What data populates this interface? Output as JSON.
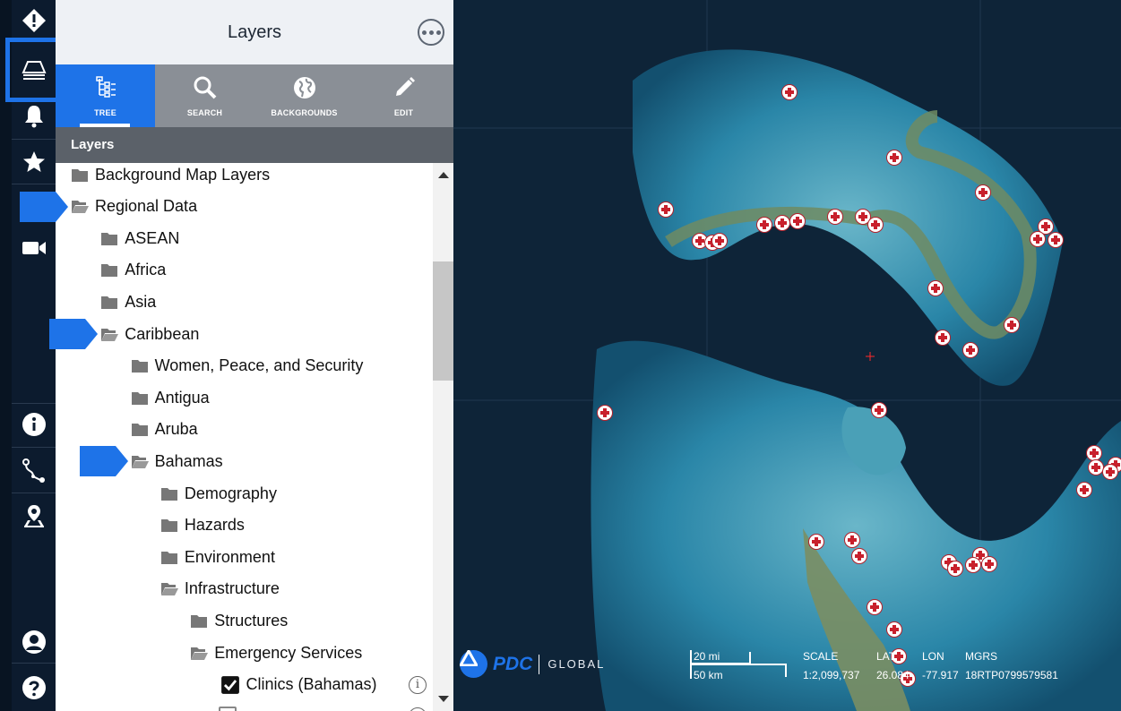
{
  "panel": {
    "title": "Layers",
    "section_header": "Layers",
    "tabs": [
      {
        "label": "TREE",
        "icon": "tree-icon",
        "active": true
      },
      {
        "label": "SEARCH",
        "icon": "search-icon",
        "active": false
      },
      {
        "label": "BACKGROUNDS",
        "icon": "globe-icon",
        "active": false
      },
      {
        "label": "EDIT",
        "icon": "pencil-icon",
        "active": false
      }
    ]
  },
  "rail": {
    "items": [
      "alert-diamond-icon",
      "layers-icon",
      "bell-icon",
      "star-icon",
      "chevron-down-icon",
      "video-camera-icon",
      "info-icon",
      "route-icon",
      "map-pin-icon",
      "user-icon",
      "help-icon"
    ]
  },
  "tree": {
    "nodes": [
      {
        "label": "Background Map Layers",
        "level": 0,
        "state": "closed"
      },
      {
        "label": "Regional Data",
        "level": 0,
        "state": "open",
        "highlight": true
      },
      {
        "label": "ASEAN",
        "level": 1,
        "state": "closed"
      },
      {
        "label": "Africa",
        "level": 1,
        "state": "closed"
      },
      {
        "label": "Asia",
        "level": 1,
        "state": "closed"
      },
      {
        "label": "Caribbean",
        "level": 1,
        "state": "open",
        "highlight": true
      },
      {
        "label": "Women, Peace, and Security",
        "level": 2,
        "state": "closed"
      },
      {
        "label": "Antigua",
        "level": 2,
        "state": "closed"
      },
      {
        "label": "Aruba",
        "level": 2,
        "state": "closed"
      },
      {
        "label": "Bahamas",
        "level": 2,
        "state": "open",
        "highlight": true
      },
      {
        "label": "Demography",
        "level": 3,
        "state": "closed"
      },
      {
        "label": "Hazards",
        "level": 3,
        "state": "closed"
      },
      {
        "label": "Environment",
        "level": 3,
        "state": "closed"
      },
      {
        "label": "Infrastructure",
        "level": 3,
        "state": "open"
      },
      {
        "label": "Structures",
        "level": 4,
        "state": "closed"
      },
      {
        "label": "Emergency Services",
        "level": 4,
        "state": "open"
      },
      {
        "label": "Clinics (Bahamas)",
        "level": 5,
        "state": "checked"
      }
    ]
  },
  "map": {
    "logo": {
      "brand": "PDC",
      "sub": "GLOBAL"
    },
    "scale_bar": {
      "miles": "20 mi",
      "km": "50 km"
    },
    "readout": {
      "scale_label": "SCALE",
      "scale_value": "1:2,099,737",
      "lat_label": "LAT",
      "lat_value": "26.084",
      "lon_label": "LON",
      "lon_value": "-77.917",
      "mgrs_label": "MGRS",
      "mgrs_value": "18RTP0799579581"
    },
    "colors": {
      "marker": "#c8202c",
      "accent": "#1e73e8"
    }
  }
}
